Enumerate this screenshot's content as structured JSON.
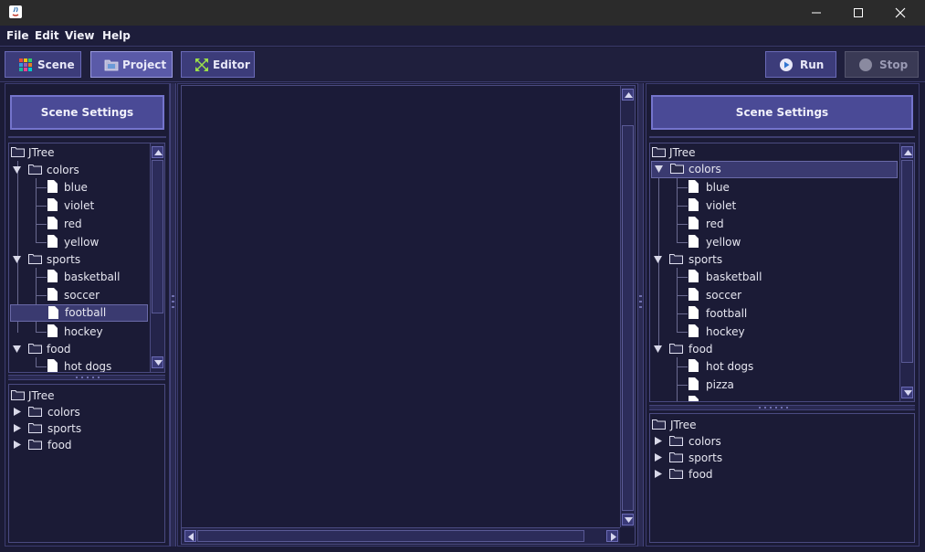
{
  "window": {
    "minimize_icon": "minimize-icon",
    "maximize_icon": "maximize-icon",
    "close_icon": "close-icon"
  },
  "menu": [
    "File",
    "Edit",
    "View",
    "Help"
  ],
  "toolbar": {
    "scene_label": "Scene",
    "project_label": "Project",
    "editor_label": "Editor",
    "run_label": "Run",
    "stop_label": "Stop"
  },
  "left_panel": {
    "scene_settings_label": "Scene Settings",
    "top_tree": {
      "root": "JTree",
      "colors": "colors",
      "colors_items": [
        "blue",
        "violet",
        "red",
        "yellow"
      ],
      "sports": "sports",
      "sports_items": [
        "basketball",
        "soccer",
        "football",
        "hockey"
      ],
      "food": "food",
      "food_items": [
        "hot dogs"
      ],
      "selected": "football"
    },
    "bottom_tree": {
      "root": "JTree",
      "nodes": [
        "colors",
        "sports",
        "food"
      ]
    }
  },
  "right_panel": {
    "scene_settings_label": "Scene Settings",
    "top_tree": {
      "root": "JTree",
      "colors": "colors",
      "colors_items": [
        "blue",
        "violet",
        "red",
        "yellow"
      ],
      "sports": "sports",
      "sports_items": [
        "basketball",
        "soccer",
        "football",
        "hockey"
      ],
      "food": "food",
      "food_items": [
        "hot dogs",
        "pizza"
      ],
      "selected": "colors"
    },
    "bottom_tree": {
      "root": "JTree",
      "nodes": [
        "colors",
        "sports",
        "food"
      ]
    }
  },
  "colors": {
    "background": "#1b1b36",
    "button": "#3c3c7a",
    "button_active": "#5a5aa8",
    "accent": "#7474cc"
  }
}
